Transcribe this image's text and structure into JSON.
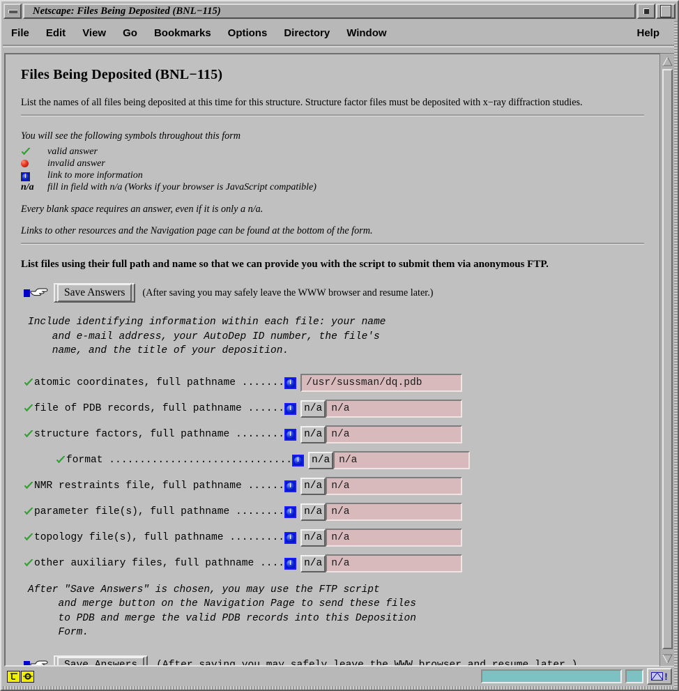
{
  "window": {
    "title": "Netscape: Files Being Deposited (BNL−115)",
    "minimize_label": "",
    "maximize_label": ""
  },
  "menubar": {
    "items": [
      {
        "label": "File"
      },
      {
        "label": "Edit"
      },
      {
        "label": "View"
      },
      {
        "label": "Go"
      },
      {
        "label": "Bookmarks"
      },
      {
        "label": "Options"
      },
      {
        "label": "Directory"
      },
      {
        "label": "Window"
      }
    ],
    "help_label": "Help"
  },
  "page": {
    "title": "Files Being Deposited (BNL−115)",
    "intro": "List the names of all files being deposited at this time for this structure. Structure factor files must be deposited with x−ray diffraction studies.",
    "legend_intro": "You will see the following symbols throughout this form",
    "legend": [
      {
        "symbol": "check-icon",
        "symbol_text": "",
        "description": "valid answer"
      },
      {
        "symbol": "red-ball-icon",
        "symbol_text": "",
        "description": "invalid answer"
      },
      {
        "symbol": "info-icon",
        "symbol_text": "",
        "description": "link to more information"
      },
      {
        "symbol": "na-text",
        "symbol_text": "n/a",
        "description": "fill in field with n/a (Works if your browser is JavaScript compatible)"
      }
    ],
    "note_blank": "Every blank space requires an answer, even if it is only a n/a.",
    "note_links": "Links to other resources and the Navigation page can be found at the bottom of the form.",
    "lead": "List files using their full path and name so that we can provide you with the script to submit them via anonymous FTP.",
    "save_top": {
      "button_label": "Save Answers",
      "hint": "(After saving you may safely leave the WWW browser and resume later.)"
    },
    "mono_top": "Include identifying information within each file: your name\n    and e-mail address, your AutoDep ID number, the file's\n    name, and the title of your deposition.",
    "mono_bottom": "After \"Save Answers\" is chosen, you may use the FTP script\n     and merge button on the Navigation Page to send these files\n     to PDB and merge the valid PDB records into this Deposition\n     Form.",
    "save_bottom": {
      "button_label": "Save Answers",
      "hint": "(After saving you may safely leave the WWW browser and resume later.)"
    },
    "fields": [
      {
        "name": "atomic-coordinates",
        "label": "atomic coordinates, full pathname .......",
        "status": "valid",
        "has_na_button": false,
        "na_label": "",
        "value": "/usr/sussman/dq.pdb",
        "indent": 0,
        "input_width": 232,
        "label_gap": 0
      },
      {
        "name": "pdb-records-file",
        "label": "file of PDB records, full pathname ......",
        "status": "valid",
        "has_na_button": true,
        "na_label": "n/a",
        "value": "n/a",
        "indent": 0,
        "input_width": 196,
        "label_gap": 0
      },
      {
        "name": "structure-factors",
        "label": "structure factors, full pathname ........",
        "status": "valid",
        "has_na_button": true,
        "na_label": "n/a",
        "value": "n/a",
        "indent": 0,
        "input_width": 196,
        "label_gap": 0
      },
      {
        "name": "format",
        "label": "format ..............................",
        "status": "valid",
        "has_na_button": true,
        "na_label": "n/a",
        "value": "n/a",
        "indent": 46,
        "input_width": 196,
        "label_gap": 0
      },
      {
        "name": "nmr-restraints",
        "label": "NMR restraints file, full pathname ......",
        "status": "valid",
        "has_na_button": true,
        "na_label": "n/a",
        "value": "n/a",
        "indent": 0,
        "input_width": 196,
        "label_gap": 0
      },
      {
        "name": "parameter-files",
        "label": "parameter file(s), full pathname ........",
        "status": "valid",
        "has_na_button": true,
        "na_label": "n/a",
        "value": "n/a",
        "indent": 0,
        "input_width": 196,
        "label_gap": 0
      },
      {
        "name": "topology-files",
        "label": "topology file(s), full pathname .........",
        "status": "valid",
        "has_na_button": true,
        "na_label": "n/a",
        "value": "n/a",
        "indent": 0,
        "input_width": 196,
        "label_gap": 0
      },
      {
        "name": "other-auxiliary-files",
        "label": "other auxiliary files, full pathname ....",
        "status": "valid",
        "has_na_button": true,
        "na_label": "n/a",
        "value": "n/a",
        "indent": 0,
        "input_width": 196,
        "label_gap": 0
      }
    ]
  },
  "statusbar": {
    "message": "",
    "security_icon": "security-icon",
    "throbber_icon": "netscape-icon",
    "mail_icon": "mail-envelope-icon"
  },
  "colors": {
    "window_bg": "#b8b8b8",
    "content_bg": "#c0c0c0",
    "input_bg": "#d8b9bc",
    "info_blue": "#0018c8",
    "check_green": "#2fb02f",
    "ball_red": "#e8321a",
    "progress_teal": "#7cc2c2",
    "status_yellow": "#efef00"
  }
}
